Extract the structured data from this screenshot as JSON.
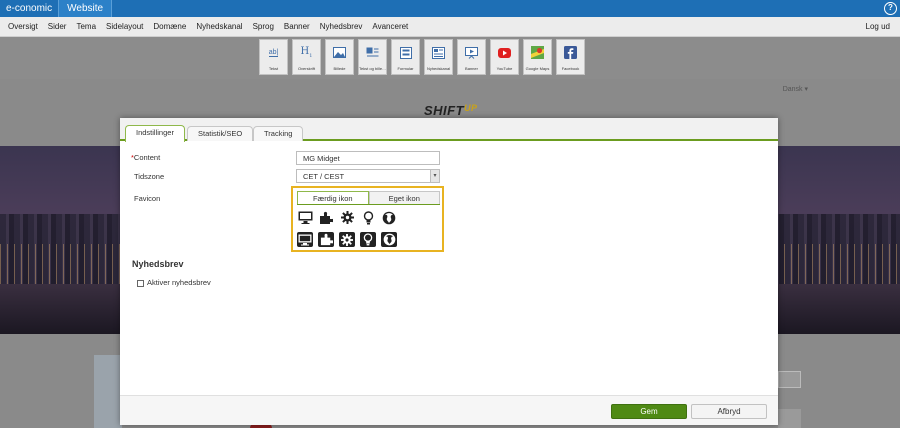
{
  "topbar": {
    "brand": "e-conomic",
    "app_tab": "Website",
    "help": "?"
  },
  "menu": {
    "items": [
      "Oversigt",
      "Sider",
      "Tema",
      "Sidelayout",
      "Domæne",
      "Nyhedskanal",
      "Sprog",
      "Banner",
      "Nyhedsbrev",
      "Avanceret"
    ],
    "logout": "Log ud"
  },
  "toolbar": {
    "tools": [
      {
        "label": "Tekst",
        "icon": "text-icon"
      },
      {
        "label": "Overskrift",
        "icon": "heading-icon"
      },
      {
        "label": "Billede",
        "icon": "image-icon"
      },
      {
        "label": "Tekst og bille…",
        "icon": "text-image-icon"
      },
      {
        "label": "Formular",
        "icon": "form-icon"
      },
      {
        "label": "Nyhedskanal",
        "icon": "news-icon"
      },
      {
        "label": "Banner",
        "icon": "banner-icon"
      },
      {
        "label": "YouTube",
        "icon": "youtube-icon"
      },
      {
        "label": "Google Maps",
        "icon": "maps-icon"
      },
      {
        "label": "Facebook",
        "icon": "facebook-icon"
      }
    ]
  },
  "site": {
    "language": "Dansk",
    "logo_main": "SHIFT",
    "logo_accent": "UP"
  },
  "dialog": {
    "tabs": [
      "Indstillinger",
      "Statistik/SEO",
      "Tracking"
    ],
    "content_label": "Content",
    "content_required": "*",
    "content_value": "MG Midget",
    "timezone_label": "Tidszone",
    "timezone_value": "CET / CEST",
    "favicon_label": "Favicon",
    "favicon_tabs": [
      "Færdig ikon",
      "Eget ikon"
    ],
    "favicon_icons": [
      "monitor-icon",
      "puzzle-icon",
      "gear-icon",
      "lightbulb-icon",
      "globe-icon"
    ],
    "newsletter_title": "Nyhedsbrev",
    "newsletter_checkbox_label": "Aktiver nyhedsbrev",
    "newsletter_checked": false,
    "save_label": "Gem",
    "cancel_label": "Afbryd"
  },
  "colors": {
    "brand_blue": "#1e6fb5",
    "accent_green": "#6b9c1f",
    "save_green": "#4f8a14",
    "highlight_yellow": "#e8b321"
  }
}
